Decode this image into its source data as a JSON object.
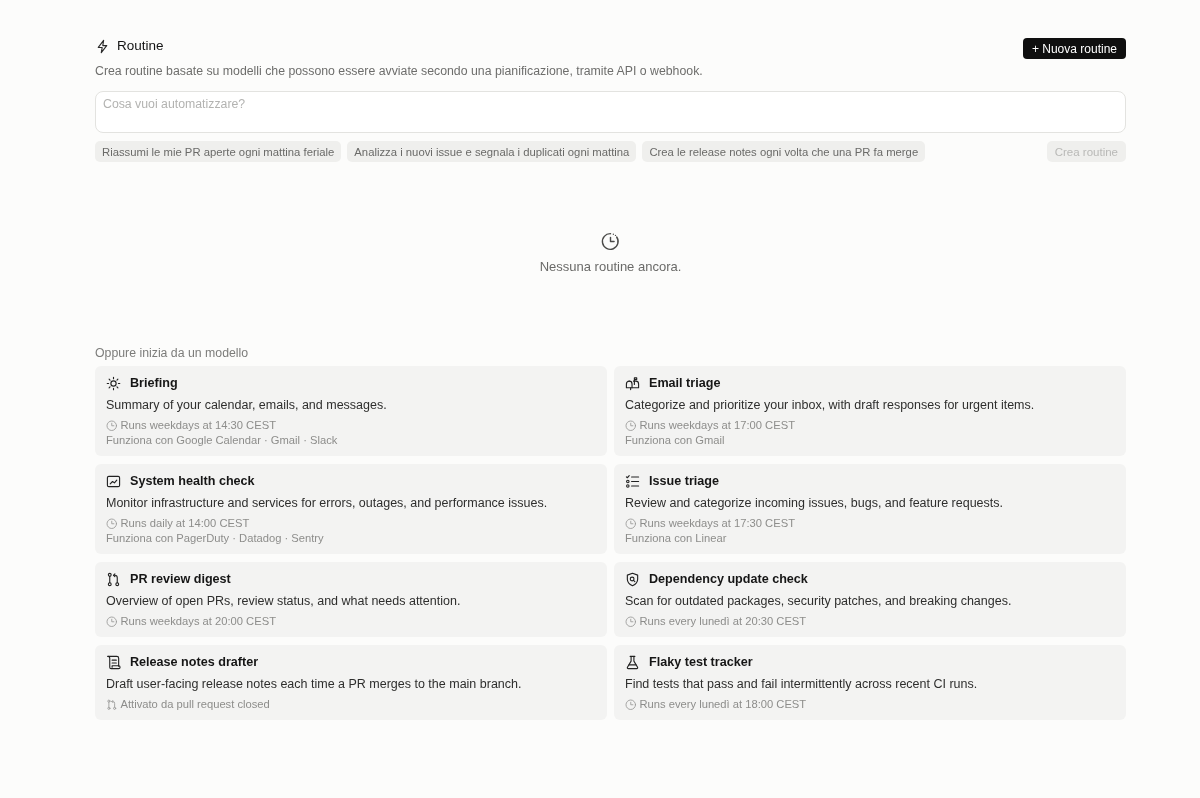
{
  "header": {
    "title": "Routine",
    "subtitle": "Crea routine basate su modelli che possono essere avviate secondo una pianificazione, tramite API o webhook.",
    "new_button": "+ Nuova routine"
  },
  "composer": {
    "placeholder": "Cosa vuoi automatizzare?",
    "suggestions": [
      "Riassumi le mie PR aperte ogni mattina feriale",
      "Analizza i nuovi issue e segnala i duplicati ogni mattina",
      "Crea le release notes ogni volta che una PR fa merge"
    ],
    "submit": {
      "label": "Crea routine",
      "disabled": true
    }
  },
  "empty_state": {
    "message": "Nessuna routine ancora."
  },
  "templates": {
    "heading": "Oppure inizia da un modello",
    "items": [
      {
        "title": "Briefing",
        "description": "Summary of your calendar, emails, and messages.",
        "trigger": {
          "kind": "schedule",
          "text": "Runs weekdays at 14:30 CEST"
        },
        "integrations": "Funziona con Google Calendar · Gmail · Slack"
      },
      {
        "title": "Email triage",
        "description": "Categorize and prioritize your inbox, with draft responses for urgent items.",
        "trigger": {
          "kind": "schedule",
          "text": "Runs weekdays at 17:00 CEST"
        },
        "integrations": "Funziona con Gmail"
      },
      {
        "title": "System health check",
        "description": "Monitor infrastructure and services for errors, outages, and performance issues.",
        "trigger": {
          "kind": "schedule",
          "text": "Runs daily at 14:00 CEST"
        },
        "integrations": "Funziona con PagerDuty · Datadog · Sentry"
      },
      {
        "title": "Issue triage",
        "description": "Review and categorize incoming issues, bugs, and feature requests.",
        "trigger": {
          "kind": "schedule",
          "text": "Runs weekdays at 17:30 CEST"
        },
        "integrations": "Funziona con Linear"
      },
      {
        "title": "PR review digest",
        "description": "Overview of open PRs, review status, and what needs attention.",
        "trigger": {
          "kind": "schedule",
          "text": "Runs weekdays at 20:00 CEST"
        }
      },
      {
        "title": "Dependency update check",
        "description": "Scan for outdated packages, security patches, and breaking changes.",
        "trigger": {
          "kind": "schedule",
          "text": "Runs every lunedì at 20:30 CEST"
        }
      },
      {
        "title": "Release notes drafter",
        "description": "Draft user-facing release notes each time a PR merges to the main branch.",
        "trigger": {
          "kind": "event",
          "text": "Attivato da pull request closed"
        }
      },
      {
        "title": "Flaky test tracker",
        "description": "Find tests that pass and fail intermittently across recent CI runs.",
        "trigger": {
          "kind": "schedule",
          "text": "Runs every lunedì at 18:00 CEST"
        }
      }
    ]
  }
}
